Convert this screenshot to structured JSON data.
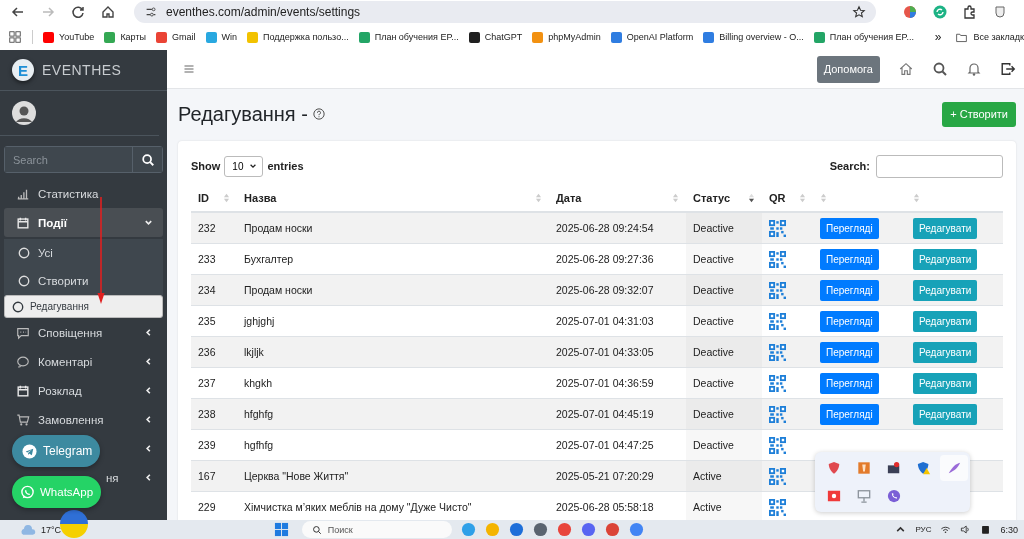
{
  "browser": {
    "url": "eventhes.com/admin/events/settings",
    "more": "»",
    "all_bookmarks": "Все закладк",
    "bookmarks": [
      {
        "label": "YouTube",
        "color": "#ff0000"
      },
      {
        "label": "Карты",
        "color": "#34a853"
      },
      {
        "label": "Gmail",
        "color": "#ea4335"
      },
      {
        "label": "Win",
        "color": "#29a8e0"
      },
      {
        "label": "Поддержка пользо...",
        "color": "#f2c200"
      },
      {
        "label": "План обучения EP...",
        "color": "#23a566"
      },
      {
        "label": "ChatGPT",
        "color": "#202020"
      },
      {
        "label": "phpMyAdmin",
        "color": "#f29111"
      },
      {
        "label": "OpenAI Platform",
        "color": "#2f7de1"
      },
      {
        "label": "Billing overview - O...",
        "color": "#2f7de1"
      },
      {
        "label": "План обучения EP...",
        "color": "#23a566"
      }
    ]
  },
  "sidebar": {
    "logo_letter": "E",
    "brand": "EVENTHES",
    "search": {
      "placeholder": "Search"
    },
    "items": [
      {
        "kind": "link",
        "label": "Статистика"
      },
      {
        "kind": "group",
        "label": "Події",
        "expanded": true,
        "children": [
          {
            "label": "Усі",
            "selected": false
          },
          {
            "label": "Створити",
            "selected": false
          },
          {
            "label": "Редагування",
            "selected": true
          }
        ]
      },
      {
        "kind": "group",
        "label": "Сповіщення",
        "expanded": false
      },
      {
        "kind": "group",
        "label": "Коментарі",
        "expanded": false
      },
      {
        "kind": "group",
        "label": "Розклад",
        "expanded": false
      },
      {
        "kind": "group",
        "label": "Замовлення",
        "expanded": false
      },
      {
        "kind": "group",
        "expanded": false
      },
      {
        "kind": "group",
        "label": "ня",
        "expanded": false
      }
    ]
  },
  "floating_buttons": [
    {
      "kind": "telegram",
      "label": "Telegram"
    },
    {
      "kind": "whatsapp",
      "label": "WhatsApp"
    }
  ],
  "navbar": {
    "help": "Допомога"
  },
  "page": {
    "title": "Редагування -",
    "create_button": "+ Створити"
  },
  "table": {
    "show": "Show",
    "page_size": "10",
    "entries": "entries",
    "search_label": "Search:",
    "columns": [
      {
        "label": "ID",
        "sorted": false
      },
      {
        "label": "Назва",
        "sorted": false
      },
      {
        "label": "Дата",
        "sorted": false
      },
      {
        "label": "Статус",
        "sorted": true
      },
      {
        "label": "QR",
        "sorted": false
      },
      {
        "sorted": false
      },
      {
        "sorted": false
      }
    ],
    "rows": [
      {
        "id": "232",
        "name": "Продам носки",
        "date": "2025-06-28 09:24:54",
        "status": "Deactive",
        "view": "Переглядi",
        "edit": "Редагувати"
      },
      {
        "id": "233",
        "name": "Бухгалтер",
        "date": "2025-06-28 09:27:36",
        "status": "Deactive",
        "view": "Переглядi",
        "edit": "Редагувати"
      },
      {
        "id": "234",
        "name": "Продам носки",
        "date": "2025-06-28 09:32:07",
        "status": "Deactive",
        "view": "Переглядi",
        "edit": "Редагувати"
      },
      {
        "id": "235",
        "name": "jghjghj",
        "date": "2025-07-01 04:31:03",
        "status": "Deactive",
        "view": "Переглядi",
        "edit": "Редагувати"
      },
      {
        "id": "236",
        "name": "lkjljk",
        "date": "2025-07-01 04:33:05",
        "status": "Deactive",
        "view": "Переглядi",
        "edit": "Редагувати"
      },
      {
        "id": "237",
        "name": "khgkh",
        "date": "2025-07-01 04:36:59",
        "status": "Deactive",
        "view": "Переглядi",
        "edit": "Редагувати"
      },
      {
        "id": "238",
        "name": "hfghfg",
        "date": "2025-07-01 04:45:19",
        "status": "Deactive",
        "view": "Переглядi",
        "edit": "Редагувати"
      },
      {
        "id": "239",
        "name": "hgfhfg",
        "date": "2025-07-01 04:47:25",
        "status": "Deactive"
      },
      {
        "id": "167",
        "name": "Церква \"Нове Життя\"",
        "date": "2025-05-21 07:20:29",
        "status": "Active"
      },
      {
        "id": "229",
        "name": "Хімчистка м’яких меблів на дому \"Дуже Чисто\"",
        "date": "2025-06-28 05:58:18",
        "status": "Active"
      }
    ]
  },
  "tray_popup": {
    "icons": [
      {
        "kind": "shield",
        "selected": false
      },
      {
        "kind": "box",
        "selected": false
      },
      {
        "kind": "monitor",
        "selected": false
      },
      {
        "kind": "warning",
        "selected": false
      },
      {
        "kind": "feather",
        "selected": true
      },
      {
        "kind": "record",
        "selected": false
      },
      {
        "kind": "projector",
        "selected": false
      },
      {
        "kind": "phone",
        "selected": false
      }
    ]
  },
  "taskbar": {
    "temperature": "17°C",
    "search_placeholder": "Поиск",
    "language": "РУС",
    "time": "6:30"
  }
}
